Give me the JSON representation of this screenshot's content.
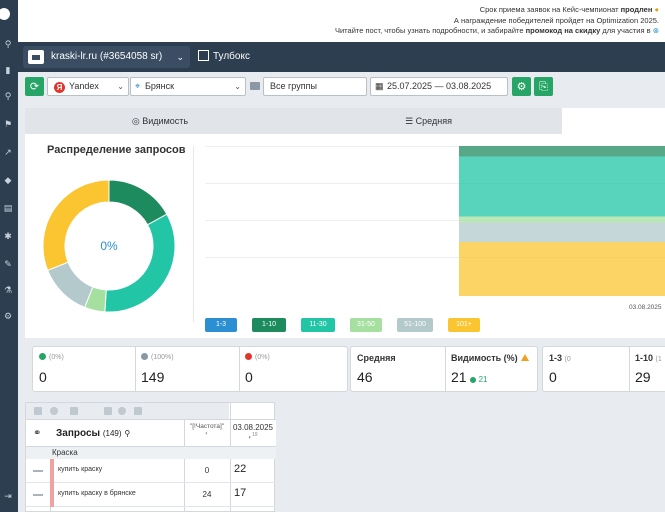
{
  "announcement": {
    "line1_pre": "Срок приема заявок на Кейс-чемпионат ",
    "line1_bold": "продлен",
    "line2": "А награждение победителей пройдет на Optimization 2025.",
    "line3_pre": "Читайте пост, чтобы узнать подробности, и забирайте ",
    "line3_bold": "промокод на скидку",
    "line3_post": " для участия в"
  },
  "topbar": {
    "project": "kraski-lr.ru (#3654058 sr)",
    "toolbox": "Тулбокс"
  },
  "filters": {
    "engine": "Yandex",
    "region": "Брянск",
    "groups": "Все группы",
    "date_range": "25.07.2025 — 03.08.2025"
  },
  "tabs": {
    "visibility": "Видимость",
    "average": "Средняя"
  },
  "distribution": {
    "title": "Распределение запросов",
    "center_label": "0%"
  },
  "chart_data": {
    "type": "area",
    "x": [
      "03.08.2025"
    ],
    "series": [
      {
        "name": "1-3",
        "color": "#2b8fd1",
        "values": [
          0
        ]
      },
      {
        "name": "1-10",
        "color": "#1e8b5f",
        "values": [
          7
        ]
      },
      {
        "name": "11-30",
        "color": "#22c5a5",
        "values": [
          40
        ]
      },
      {
        "name": "31-50",
        "color": "#a6e0a0",
        "values": [
          4
        ]
      },
      {
        "name": "51-100",
        "color": "#b3c9cc",
        "values": [
          13
        ]
      },
      {
        "name": "101+",
        "color": "#fbc531",
        "values": [
          36
        ]
      }
    ],
    "donut": [
      {
        "name": "1-10",
        "value": 17,
        "color": "#1e8b5f"
      },
      {
        "name": "11-30",
        "value": 34,
        "color": "#22c5a5"
      },
      {
        "name": "31-50",
        "value": 5,
        "color": "#a6e0a0"
      },
      {
        "name": "51-100",
        "value": 13,
        "color": "#b3c9cc"
      },
      {
        "name": "101+",
        "value": 31,
        "color": "#fbc531"
      }
    ],
    "legend": [
      "1-3",
      "1-10",
      "11-30",
      "31-50",
      "51-100",
      "101+"
    ]
  },
  "stats": {
    "up": {
      "cap": "(0%)",
      "value": "0"
    },
    "same": {
      "cap": "(100%)",
      "value": "149"
    },
    "down": {
      "cap": "(0%)",
      "value": "0"
    },
    "average": {
      "cap": "Средняя",
      "value": "46"
    },
    "visibility": {
      "cap": "Видимость (%)",
      "value": "21",
      "delta": "21"
    },
    "top3": {
      "cap": "1-3",
      "cap2": "(0",
      "value": "0"
    },
    "top10": {
      "cap": "1-10",
      "cap2": "(1",
      "value": "29"
    }
  },
  "table": {
    "header_queries": "Запросы",
    "header_count": "(149)",
    "header_freq": "\"[!Частота]\"",
    "header_date": "03.08.2025",
    "header_date_sub": "19",
    "group": "Краска",
    "rows": [
      {
        "query": "купить краску",
        "freq": "0",
        "pos": "22"
      },
      {
        "query": "купить краску в брянске",
        "freq": "24",
        "pos": "17"
      }
    ]
  }
}
